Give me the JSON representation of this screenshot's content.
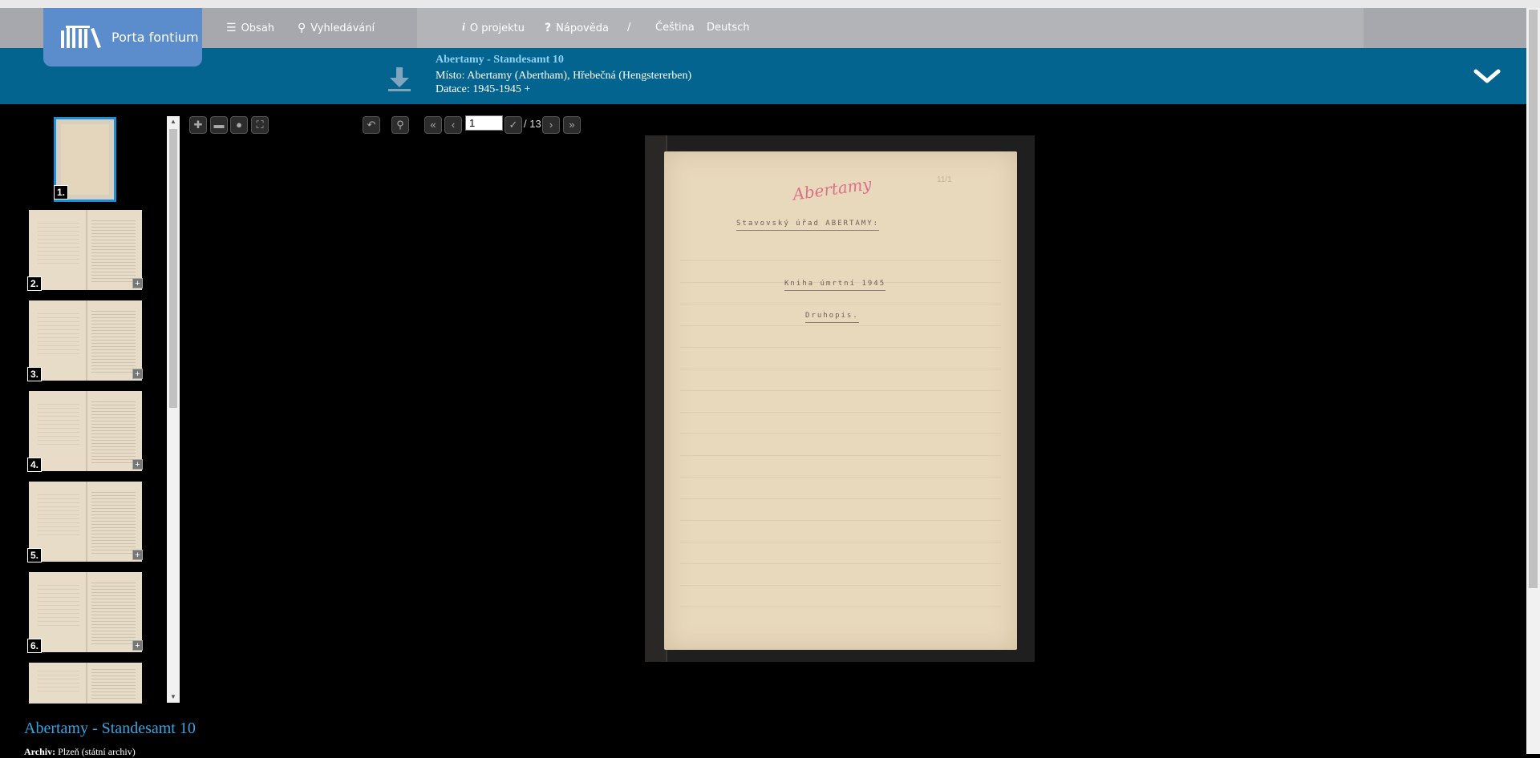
{
  "header": {
    "logo_text": "Porta fontium",
    "nav": {
      "contents": "Obsah",
      "search": "Vyhledávání",
      "about": "O projektu",
      "help": "Nápověda",
      "separator": "/",
      "lang_cs": "Čeština",
      "lang_de": "Deutsch"
    }
  },
  "record": {
    "title": "Abertamy - Standesamt 10",
    "place": "Místo: Abertamy (Abertham), Hřebečná (Hengstererben)",
    "date": "Datace: 1945-1945 +"
  },
  "thumbnails": {
    "items": [
      {
        "num": "1."
      },
      {
        "num": "2."
      },
      {
        "num": "3."
      },
      {
        "num": "4."
      },
      {
        "num": "5."
      },
      {
        "num": "6."
      }
    ],
    "plus": "+"
  },
  "viewer": {
    "page_value": "1",
    "page_total": "/ 13"
  },
  "document": {
    "stamp": "Abertamy",
    "line1": "Stavovský úřad ABERTAMY:",
    "line2": "Kniha úmrtní 1945",
    "line3": "Druhopis.",
    "corner_mark": "11/1"
  },
  "footer": {
    "title": "Abertamy - Standesamt 10",
    "archive_label": "Archiv:",
    "archive_value": "Plzeň (státní archiv)"
  },
  "colors": {
    "nav_bg": "#a6a8ad",
    "logo_bg": "#5b8ccb",
    "infobar_bg": "#03648f",
    "title_accent": "#8fd3f4",
    "footer_title": "#2fa6e6"
  }
}
